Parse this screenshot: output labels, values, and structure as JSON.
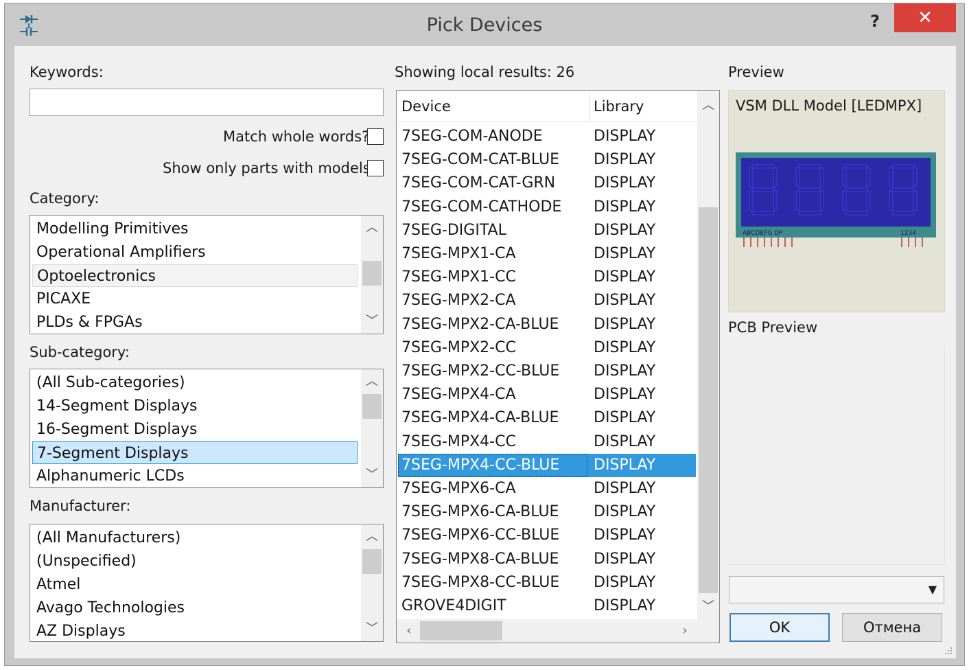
{
  "window": {
    "title": "Pick Devices",
    "help_label": "?",
    "close_label": "✕"
  },
  "left": {
    "keywords_label": "Keywords:",
    "keywords_value": "",
    "match_whole_words_label": "Match whole words?",
    "show_models_label": "Show only parts with models?",
    "category_label": "Category:",
    "categories": [
      "Modelling Primitives",
      "Operational Amplifiers",
      "Optoelectronics",
      "PICAXE",
      "PLDs & FPGAs"
    ],
    "subcategory_label": "Sub-category:",
    "subcategories": [
      "(All Sub-categories)",
      "14-Segment Displays",
      "16-Segment Displays",
      "7-Segment Displays",
      "Alphanumeric LCDs"
    ],
    "manufacturer_label": "Manufacturer:",
    "manufacturers": [
      "(All Manufacturers)",
      "(Unspecified)",
      "Atmel",
      "Avago Technologies",
      "AZ Displays"
    ]
  },
  "results": {
    "count_label": "Showing local results: 26",
    "col_device": "Device",
    "col_library": "Library",
    "rows": [
      {
        "device": "7SEG-COM-ANODE",
        "library": "DISPLAY"
      },
      {
        "device": "7SEG-COM-CAT-BLUE",
        "library": "DISPLAY"
      },
      {
        "device": "7SEG-COM-CAT-GRN",
        "library": "DISPLAY"
      },
      {
        "device": "7SEG-COM-CATHODE",
        "library": "DISPLAY"
      },
      {
        "device": "7SEG-DIGITAL",
        "library": "DISPLAY"
      },
      {
        "device": "7SEG-MPX1-CA",
        "library": "DISPLAY"
      },
      {
        "device": "7SEG-MPX1-CC",
        "library": "DISPLAY"
      },
      {
        "device": "7SEG-MPX2-CA",
        "library": "DISPLAY"
      },
      {
        "device": "7SEG-MPX2-CA-BLUE",
        "library": "DISPLAY"
      },
      {
        "device": "7SEG-MPX2-CC",
        "library": "DISPLAY"
      },
      {
        "device": "7SEG-MPX2-CC-BLUE",
        "library": "DISPLAY"
      },
      {
        "device": "7SEG-MPX4-CA",
        "library": "DISPLAY"
      },
      {
        "device": "7SEG-MPX4-CA-BLUE",
        "library": "DISPLAY"
      },
      {
        "device": "7SEG-MPX4-CC",
        "library": "DISPLAY"
      },
      {
        "device": "7SEG-MPX4-CC-BLUE",
        "library": "DISPLAY"
      },
      {
        "device": "7SEG-MPX6-CA",
        "library": "DISPLAY"
      },
      {
        "device": "7SEG-MPX6-CA-BLUE",
        "library": "DISPLAY"
      },
      {
        "device": "7SEG-MPX6-CC-BLUE",
        "library": "DISPLAY"
      },
      {
        "device": "7SEG-MPX8-CA-BLUE",
        "library": "DISPLAY"
      },
      {
        "device": "7SEG-MPX8-CC-BLUE",
        "library": "DISPLAY"
      },
      {
        "device": "GROVE4DIGIT",
        "library": "DISPLAY"
      }
    ]
  },
  "preview": {
    "label": "Preview",
    "model_text": "VSM DLL Model [LEDMPX]",
    "pin_label_left": "ABCDEFG  DP",
    "pin_label_right": "1234",
    "pcb_label": "PCB Preview",
    "display_color": "#2a2aa8",
    "bezel_color": "#3c8c8c"
  },
  "buttons": {
    "ok": "OK",
    "cancel": "Отмена"
  },
  "colors": {
    "selection_blue": "#3399dd",
    "close_red": "#d9403a"
  }
}
